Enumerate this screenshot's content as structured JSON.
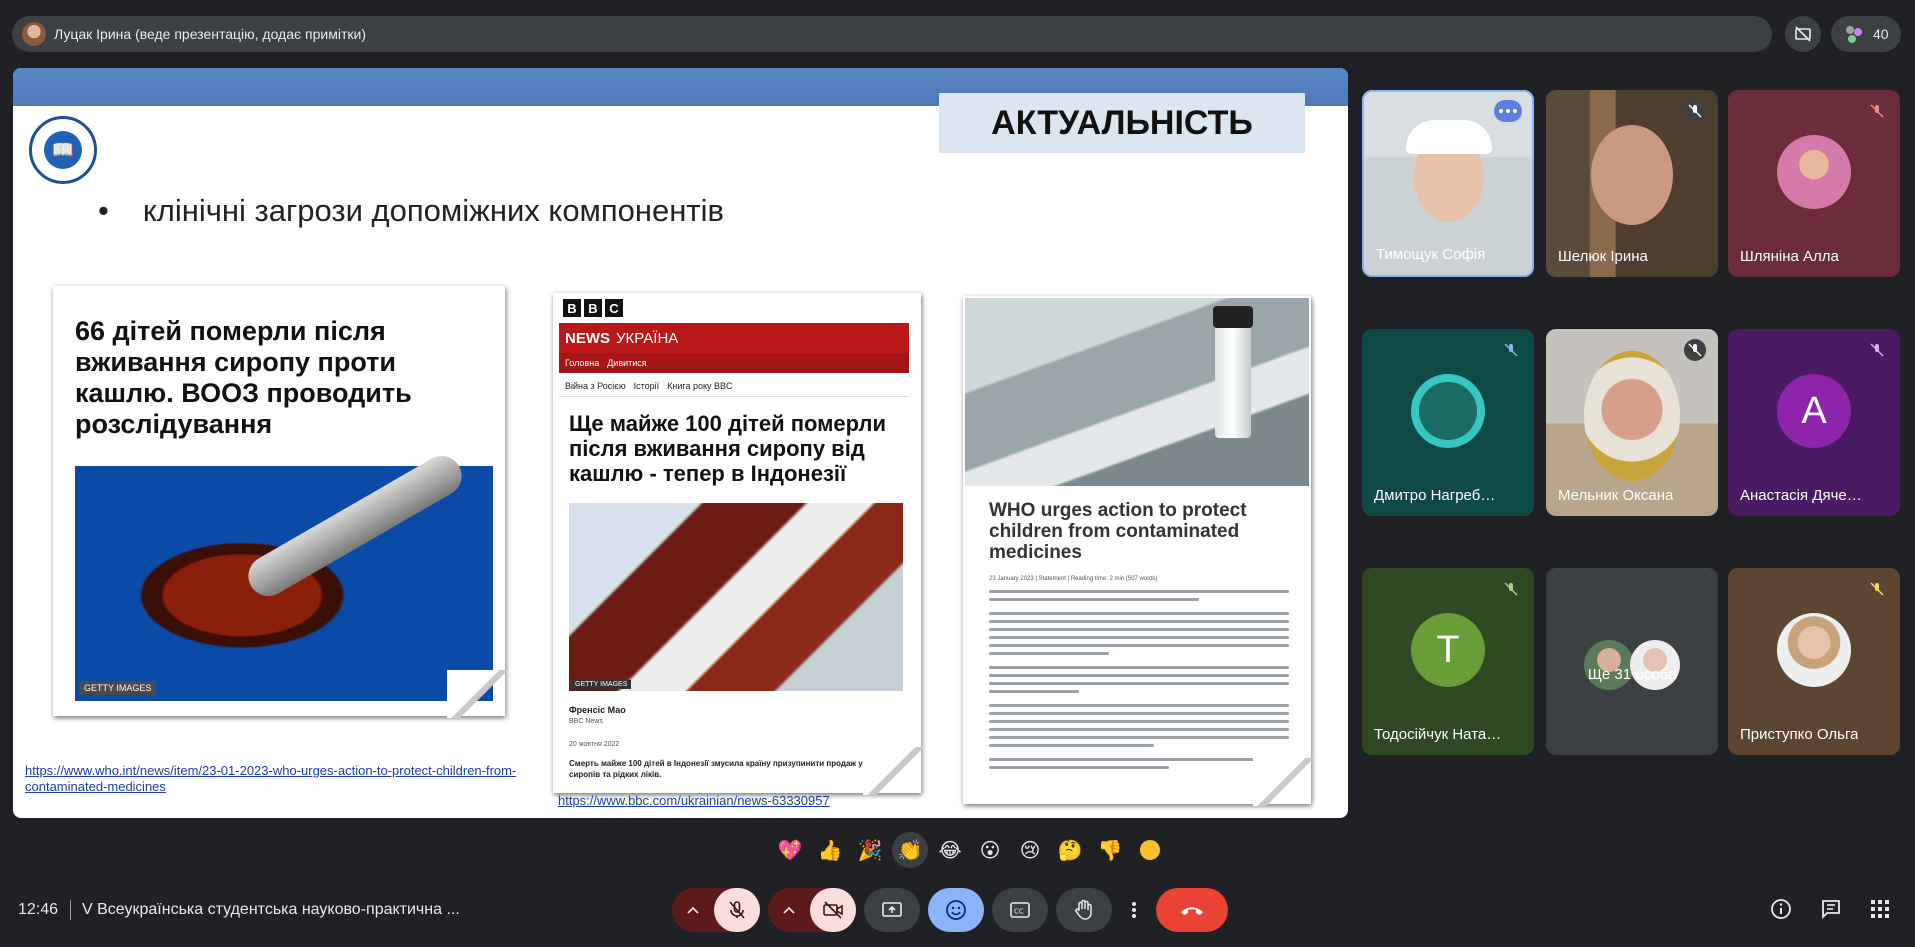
{
  "topbar": {
    "presenter": "Луцак Ірина (веде презентацію, додає примітки)"
  },
  "participants_count": "40",
  "slide": {
    "title": "АКТУАЛЬНІСТЬ",
    "bullet": "клінічні загрози допоміжних компонентів",
    "bullet_mark": "•",
    "card1": {
      "headline": "66 дітей померли після вживання сиропу проти кашлю. ВООЗ проводить розслідування",
      "credit": "GETTY IMAGES"
    },
    "card2": {
      "bbc": [
        "B",
        "B",
        "C"
      ],
      "news": "NEWS",
      "edition": "УКРАЇНА",
      "nav": [
        "Головна",
        "Дивитися"
      ],
      "subnav": [
        "Війна з Росією",
        "Історії",
        "Книга року BBC"
      ],
      "headline": "Ще майже 100 дітей померли після вживання сиропу від кашлю - тепер в Індонезії",
      "credit": "GETTY IMAGES",
      "author": "Френсіс Мао",
      "org": "BBC News",
      "date": "20 жовтня 2022",
      "lede": "Смерть майже 100 дітей в Індонезії змусила країну призупинити продаж усіх сиропів та рідких ліків."
    },
    "card3": {
      "headline": "WHO urges action to protect children from contaminated medicines",
      "meta": "23 January 2023 | Statement | Reading time: 2 min (507 words)"
    },
    "link_who": "https://www.who.int/news/item/23-01-2023-who-urges-action-to-protect-children-from-contaminated-medicines",
    "link_bbc": "https://www.bbc.com/ukrainian/news-63330957"
  },
  "participants": [
    {
      "name": "Тимощук Софія"
    },
    {
      "name": "Шелюк Ірина"
    },
    {
      "name": "Шляніна Алла"
    },
    {
      "name": "Дмитро Нагреб…"
    },
    {
      "name": "Мельник Оксана"
    },
    {
      "name": "Анастасія Дяче…",
      "initial": "A"
    },
    {
      "name": "Тодосійчук Ната…",
      "initial": "T"
    },
    {
      "name": "Ще 31 особа"
    },
    {
      "name": "Приступко Ольга"
    }
  ],
  "reactions": [
    "💖",
    "👍",
    "🎉",
    "👏",
    "😂",
    "😮",
    "😢",
    "🤔",
    "👎"
  ],
  "bottom": {
    "time": "12:46",
    "meeting": "V Всеукраїнська студентська науково-практична ..."
  },
  "colors": {
    "bg": "#202124",
    "accent": "#8ab4f8",
    "danger": "#ea4335",
    "slide_blue": "#4d79b8"
  }
}
